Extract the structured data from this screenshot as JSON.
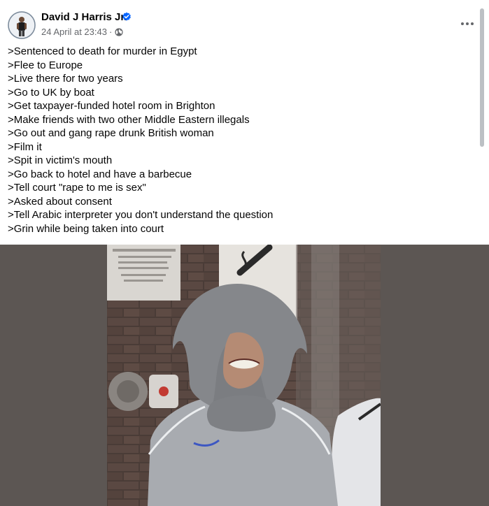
{
  "post": {
    "author_name": "David J Harris Jr.",
    "verified": true,
    "timestamp": "24 April at 23:43",
    "separator": "·",
    "audience_icon": "globe-icon",
    "more_icon": "more-options-icon",
    "lines": [
      ">Sentenced to death for murder in Egypt",
      ">Flee to Europe",
      ">Live there for two years",
      ">Go to UK by boat",
      ">Get taxpayer-funded hotel room in Brighton",
      ">Make friends with two other Middle Eastern illegals",
      ">Go out and gang rape drunk British woman",
      ">Film it",
      ">Spit in victim's mouth",
      ">Go back to hotel and have a barbecue",
      ">Tell court \"rape to me is sex\"",
      ">Asked about consent",
      ">Tell Arabic interpreter you don't understand the question",
      ">Grin while being taken into court"
    ]
  },
  "colors": {
    "text_primary": "#050505",
    "text_secondary": "#65676b",
    "verified_blue": "#0866ff",
    "media_background": "#5c5653"
  }
}
